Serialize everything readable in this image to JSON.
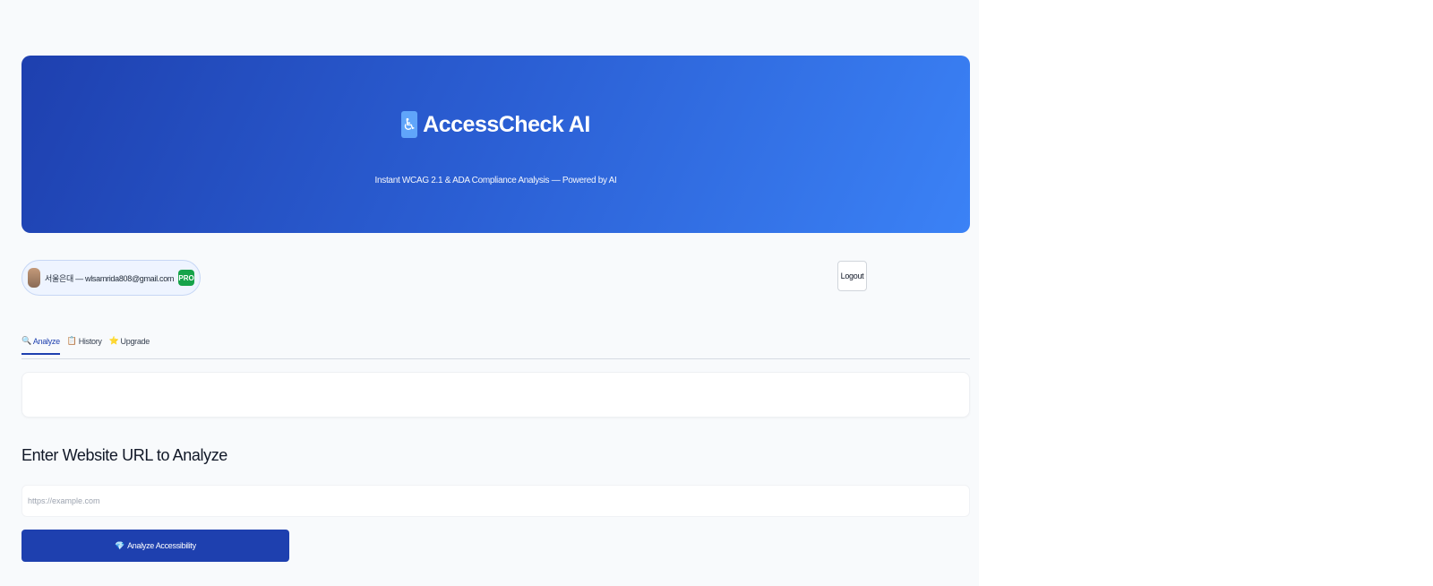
{
  "hero": {
    "icon": "wheelchair-icon",
    "icon_glyph": "♿",
    "title": "AccessCheck AI",
    "subtitle": "Instant WCAG 2.1 & ADA Compliance Analysis — Powered by AI"
  },
  "user": {
    "label": "서울은대 — wlsamrida808@gmail.com",
    "badge": "PRO",
    "badge_color": "#16a34a"
  },
  "logout": {
    "label": "Logout"
  },
  "tabs": [
    {
      "icon": "magnifier-icon",
      "glyph": "🔍",
      "label": "Analyze",
      "active": true
    },
    {
      "icon": "history-icon",
      "glyph": "📋",
      "label": "History",
      "active": false
    },
    {
      "icon": "star-icon",
      "glyph": "⭐",
      "label": "Upgrade",
      "active": false
    }
  ],
  "analyze_section": {
    "heading": "Enter Website URL to Analyze",
    "input_placeholder": "https://example.com",
    "button_label": "Analyze Accessibility",
    "button_icon": "gem-icon",
    "button_glyph": "💎"
  },
  "colors": {
    "accent": "#1e40af",
    "hero_gradient_start": "#1e40af",
    "hero_gradient_end": "#3b82f6",
    "background": "#f8fafc"
  }
}
